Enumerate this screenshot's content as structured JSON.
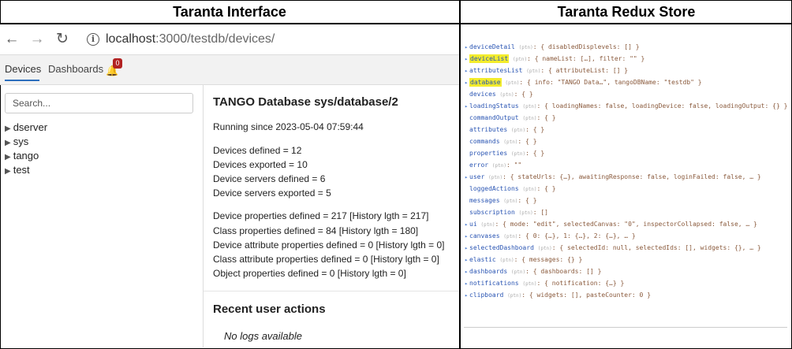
{
  "panels": {
    "left_title": "Taranta Interface",
    "right_title": "Taranta Redux Store"
  },
  "browser": {
    "url_host": "localhost",
    "url_path": ":3000/testdb/devices/"
  },
  "tabs": {
    "devices": "Devices",
    "dashboards": "Dashboards",
    "notification_count": "0"
  },
  "search": {
    "placeholder": "Search..."
  },
  "tree": [
    "dserver",
    "sys",
    "tango",
    "test"
  ],
  "main": {
    "title": "TANGO Database sys/database/2",
    "running_since": "Running since 2023-05-04 07:59:44",
    "stats": [
      "Devices defined  = 12",
      "Devices exported  = 10",
      "Device servers defined  = 6",
      "Device servers exported  = 5"
    ],
    "props": [
      "Device properties defined  = 217 [History lgth = 217]",
      "Class properties defined  = 84 [History lgth = 180]",
      "Device attribute properties defined  = 0 [History lgth = 0]",
      "Class attribute properties defined  = 0 [History lgth = 0]",
      "Object properties defined  = 0 [History lgth = 0]"
    ],
    "recent_title": "Recent user actions",
    "no_logs": "No logs available"
  },
  "store": {
    "ptn": "(ptn)",
    "lines": [
      {
        "arrow": true,
        "key": "deviceDetail",
        "val": ": { disabledDisplevels: [] }",
        "hl": false,
        "indent": false
      },
      {
        "arrow": true,
        "key": "deviceList",
        "val": ": { nameList: […], filter: \"\" }",
        "hl": true,
        "indent": false
      },
      {
        "arrow": true,
        "key": "attributesList",
        "val": ": { attributeList: [] }",
        "hl": false,
        "indent": false
      },
      {
        "arrow": true,
        "key": "database",
        "val": ": { info: \"TANGO Data…\", tangoDBName: \"testdb\" }",
        "hl": true,
        "indent": false
      },
      {
        "arrow": false,
        "key": "devices",
        "val": ": { }",
        "hl": false,
        "indent": true
      },
      {
        "arrow": true,
        "key": "loadingStatus",
        "val": ": { loadingNames: false, loadingDevice: false, loadingOutput: {} }",
        "hl": false,
        "indent": false
      },
      {
        "arrow": false,
        "key": "commandOutput",
        "val": ": { }",
        "hl": false,
        "indent": true
      },
      {
        "arrow": false,
        "key": "attributes",
        "val": ": { }",
        "hl": false,
        "indent": true
      },
      {
        "arrow": false,
        "key": "commands",
        "val": ": { }",
        "hl": false,
        "indent": true
      },
      {
        "arrow": false,
        "key": "properties",
        "val": ": { }",
        "hl": false,
        "indent": true
      },
      {
        "arrow": false,
        "key": "error",
        "val": ": \"\"",
        "hl": false,
        "indent": true
      },
      {
        "arrow": true,
        "key": "user",
        "val": ": { stateUrls: {…}, awaitingResponse: false, loginFailed: false, … }",
        "hl": false,
        "indent": false
      },
      {
        "arrow": false,
        "key": "loggedActions",
        "val": ": { }",
        "hl": false,
        "indent": true
      },
      {
        "arrow": false,
        "key": "messages",
        "val": ": { }",
        "hl": false,
        "indent": true
      },
      {
        "arrow": false,
        "key": "subscription",
        "val": ": []",
        "hl": false,
        "indent": true
      },
      {
        "arrow": true,
        "key": "ui",
        "val": ": { mode: \"edit\", selectedCanvas: \"0\", inspectorCollapsed: false, … }",
        "hl": false,
        "indent": false
      },
      {
        "arrow": true,
        "key": "canvases",
        "val": ": { 0: {…}, 1: {…}, 2: {…}, … }",
        "hl": false,
        "indent": false
      },
      {
        "arrow": true,
        "key": "selectedDashboard",
        "val": ": { selectedId: null, selectedIds: [], widgets: {}, … }",
        "hl": false,
        "indent": false
      },
      {
        "arrow": true,
        "key": "elastic",
        "val": ": { messages: {} }",
        "hl": false,
        "indent": false
      },
      {
        "arrow": true,
        "key": "dashboards",
        "val": ": { dashboards: [] }",
        "hl": false,
        "indent": false
      },
      {
        "arrow": true,
        "key": "notifications",
        "val": ": { notification: {…} }",
        "hl": false,
        "indent": false
      },
      {
        "arrow": true,
        "key": "clipboard",
        "val": ": { widgets: [], pasteCounter: 0 }",
        "hl": false,
        "indent": false
      }
    ]
  },
  "colors": {
    "highlight": "#f3ec2c",
    "tab_accent": "#2c6ebd",
    "badge": "#b22222"
  }
}
